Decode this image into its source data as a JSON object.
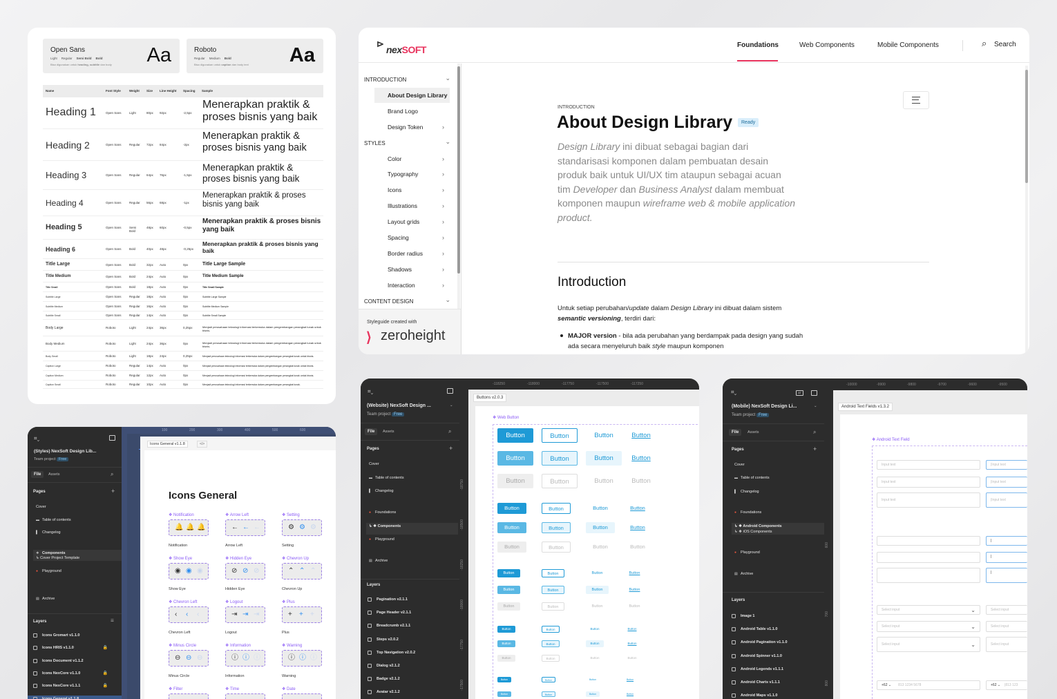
{
  "typography_card": {
    "fonts": [
      {
        "name": "Open Sans",
        "weights": [
          "Light",
          "Regular",
          "Semi Bold",
          "Bold"
        ],
        "desc_pre": "Bisa digunakan untuk ",
        "desc_bold": "heading, subtitle",
        "desc_post": " dan body",
        "sample": "Aa"
      },
      {
        "name": "Roboto",
        "weights": [
          "Regular",
          "Medium",
          "Bold"
        ],
        "desc_pre": "Bisa digunakan untuk ",
        "desc_bold": "caption",
        "desc_post": " dan body text",
        "sample": "Aa"
      }
    ],
    "columns": [
      "Name",
      "Font Style",
      "Weight",
      "Size",
      "Line Height",
      "Spacing",
      "Sample"
    ],
    "rows": [
      {
        "name": "Heading 1",
        "font": "Open Sans",
        "weight": "Light",
        "size": "80px",
        "lh": "92px",
        "sp": "-2,5px",
        "sample": "Menerapkan praktik & proses bisnis yang baik"
      },
      {
        "name": "Heading 2",
        "font": "Open Sans",
        "weight": "Regular",
        "size": "72px",
        "lh": "84px",
        "sp": "-2px",
        "sample": "Menerapkan praktik & proses bisnis yang baik"
      },
      {
        "name": "Heading 3",
        "font": "Open Sans",
        "weight": "Regular",
        "size": "64px",
        "lh": "76px",
        "sp": "-1,5px",
        "sample": "Menerapkan praktik & proses bisnis yang baik"
      },
      {
        "name": "Heading 4",
        "font": "Open Sans",
        "weight": "Regular",
        "size": "56px",
        "lh": "68px",
        "sp": "-1px",
        "sample": "Menerapkan praktik & proses bisnis yang baik"
      },
      {
        "name": "Heading 5",
        "font": "Open Sans",
        "weight": "Semi Bold",
        "size": "48px",
        "lh": "60px",
        "sp": "-0,5px",
        "sample": "Menerapkan praktik & proses bisnis yang baik"
      },
      {
        "name": "Heading 6",
        "font": "Open Sans",
        "weight": "Bold",
        "size": "40px",
        "lh": "48px",
        "sp": "-0,25px",
        "sample": "Menerapkan praktik & proses bisnis yang baik"
      },
      {
        "name": "Title Large",
        "font": "Open Sans",
        "weight": "Bold",
        "size": "32px",
        "lh": "Auto",
        "sp": "0px",
        "sample": "Title Large Sample"
      },
      {
        "name": "Title Medium",
        "font": "Open Sans",
        "weight": "Bold",
        "size": "24px",
        "lh": "Auto",
        "sp": "0px",
        "sample": "Title Medium Sample"
      },
      {
        "name": "Title Small",
        "font": "Open Sans",
        "weight": "Bold",
        "size": "18px",
        "lh": "Auto",
        "sp": "0px",
        "sample": "Title Small Sample"
      },
      {
        "name": "Subtitle Large",
        "font": "Open Sans",
        "weight": "Regular",
        "size": "18px",
        "lh": "Auto",
        "sp": "0px",
        "sample": "Subtitle Large Sample"
      },
      {
        "name": "Subtitle Medium",
        "font": "Open Sans",
        "weight": "Regular",
        "size": "16px",
        "lh": "Auto",
        "sp": "0px",
        "sample": "Subtitle Medium Sample"
      },
      {
        "name": "Subtitle Small",
        "font": "Open Sans",
        "weight": "Regular",
        "size": "14px",
        "lh": "Auto",
        "sp": "0px",
        "sample": "Subtitle Small Sample"
      },
      {
        "name": "Body Large",
        "font": "Roboto",
        "weight": "Light",
        "size": "24px",
        "lh": "36px",
        "sp": "0,25px",
        "sample": "Menjadi perusahaan teknologi informasi terkemuka dalam pengembangan perangkat lunak untuk bisnis."
      },
      {
        "name": "Body Medium",
        "font": "Roboto",
        "weight": "Light",
        "size": "24px",
        "lh": "36px",
        "sp": "0px",
        "sample": "Menjadi perusahaan teknologi informasi terkemuka dalam pengembangan perangkat lunak untuk bisnis."
      },
      {
        "name": "Body Small",
        "font": "Roboto",
        "weight": "Light",
        "size": "18px",
        "lh": "24px",
        "sp": "0,25px",
        "sample": "Menjadi perusahaan teknologi informasi terkemuka dalam pengembangan perangkat lunak untuk bisnis."
      },
      {
        "name": "Caption Large",
        "font": "Roboto",
        "weight": "Regular",
        "size": "14px",
        "lh": "Auto",
        "sp": "0px",
        "sample": "Menjadi perusahaan teknologi informasi terkemuka dalam pengembangan perangkat lunak untuk bisnis."
      },
      {
        "name": "Caption Medium",
        "font": "Roboto",
        "weight": "Regular",
        "size": "12px",
        "lh": "Auto",
        "sp": "0px",
        "sample": "Menjadi perusahaan teknologi informasi terkemuka dalam pengembangan perangkat lunak untuk bisnis."
      },
      {
        "name": "Caption Small",
        "font": "Roboto",
        "weight": "Regular",
        "size": "10px",
        "lh": "Auto",
        "sp": "0px",
        "sample": "Menjadi perusahaan teknologi informasi terkemuka dalam pengembangan perangkat lunak."
      }
    ]
  },
  "docs_site": {
    "logo_pre": "nex",
    "logo_post": "SOFT",
    "nav": [
      "Foundations",
      "Web Components",
      "Mobile Components"
    ],
    "search": "Search",
    "sidebar": [
      {
        "type": "head",
        "label": "INTRODUCTION",
        "chev": "⌄"
      },
      {
        "type": "item",
        "label": "About Design Library",
        "active": true,
        "chev": ""
      },
      {
        "type": "item",
        "label": "Brand Logo",
        "chev": ""
      },
      {
        "type": "item",
        "label": "Design Token",
        "chev": "›"
      },
      {
        "type": "head",
        "label": "STYLES",
        "chev": "⌄"
      },
      {
        "type": "item",
        "label": "Color",
        "chev": "›"
      },
      {
        "type": "item",
        "label": "Typography",
        "chev": "›"
      },
      {
        "type": "item",
        "label": "Icons",
        "chev": "›"
      },
      {
        "type": "item",
        "label": "Illustrations",
        "chev": "›"
      },
      {
        "type": "item",
        "label": "Layout grids",
        "chev": "›"
      },
      {
        "type": "item",
        "label": "Spacing",
        "chev": "›"
      },
      {
        "type": "item",
        "label": "Border radius",
        "chev": "›"
      },
      {
        "type": "item",
        "label": "Shadows",
        "chev": "›"
      },
      {
        "type": "item",
        "label": "Interaction",
        "chev": "›"
      },
      {
        "type": "head",
        "label": "CONTENT DESIGN",
        "chev": "⌄"
      }
    ],
    "styleguide_caption": "Styleguide created with",
    "zeroheight": "zeroheight",
    "eyebrow": "INTRODUCTION",
    "title": "About Design Library",
    "badge": "Ready",
    "lead_parts": [
      {
        "t": "Design Library",
        "i": true
      },
      {
        "t": " ini dibuat sebagai bagian dari standarisasi komponen dalam pembuatan desain produk baik untuk UI/UX tim ataupun sebagai acuan tim ",
        "i": false
      },
      {
        "t": "Developer",
        "i": true
      },
      {
        "t": " dan ",
        "i": false
      },
      {
        "t": "Business Analyst",
        "i": true
      },
      {
        "t": " dalam membuat komponen maupun ",
        "i": false
      },
      {
        "t": "wireframe web & mobile application product.",
        "i": true
      }
    ],
    "section_title": "Introduction",
    "para_parts": [
      {
        "t": "Untuk setiap perubahan/",
        "s": ""
      },
      {
        "t": "update",
        "s": "i"
      },
      {
        "t": " dalam ",
        "s": ""
      },
      {
        "t": "Design Library",
        "s": "i"
      },
      {
        "t": " ini dibuat dalam sistem ",
        "s": ""
      },
      {
        "t": "semantic versioning",
        "s": "bi"
      },
      {
        "t": ", terdiri dari:",
        "s": ""
      }
    ],
    "bullet_parts": [
      {
        "t": "MAJOR version",
        "s": "b"
      },
      {
        "t": " - bila ada perubahan yang berdampak pada design yang sudah ada secara menyeluruh baik ",
        "s": ""
      },
      {
        "t": "style",
        "s": "i"
      },
      {
        "t": " maupun komponen",
        "s": ""
      }
    ],
    "accent": "#e8335d"
  },
  "figma_icons": {
    "project": "(Styles) NexSoft Design Lib...",
    "team": "Team project",
    "plan": "Free",
    "tabs": [
      "File",
      "Assets"
    ],
    "pages_label": "Pages",
    "pages": [
      {
        "label": "Cover",
        "icon": ""
      },
      {
        "label": "Table of contents",
        "icon": "▬"
      },
      {
        "label": "Changelog",
        "icon": "▌"
      },
      {
        "label": "Components",
        "icon": "❖",
        "bold": true
      },
      {
        "label": "↳ Cover Project Template",
        "icon": ""
      },
      {
        "label": "Playground",
        "icon": "●"
      },
      {
        "label": "Archive",
        "icon": "▤"
      }
    ],
    "layers_label": "Layers",
    "layers": [
      "Icons Gromart v1.1.0",
      "Icons HRIS v1.1.0",
      "Icons Document v1.1.2",
      "Icons NexCore v1.1.0",
      "Icons NexCore v1.1.1",
      "Icons General v1.1.8"
    ],
    "ruler": [
      "100",
      "200",
      "300",
      "400",
      "500",
      "600"
    ],
    "frame_tag": "Icons General v1.1.8",
    "heading": "Icons General",
    "icons": [
      {
        "label": "Notification",
        "cap": "Notification",
        "g": [
          "🔔",
          "🔔",
          "🔔"
        ]
      },
      {
        "label": "Arrow Left",
        "cap": "Arrow Left",
        "g": [
          "←",
          "←",
          "←"
        ]
      },
      {
        "label": "Setting",
        "cap": "Setting",
        "g": [
          "⚙",
          "⚙",
          "⚙"
        ]
      },
      {
        "label": "Show Eye",
        "cap": "Show Eye",
        "g": [
          "◉",
          "◉",
          "◉"
        ]
      },
      {
        "label": "Hidden Eye",
        "cap": "Hidden Eye",
        "g": [
          "⊘",
          "⊘",
          "⊘"
        ]
      },
      {
        "label": "Chevron Up",
        "cap": "Chevron Up",
        "g": [
          "⌃",
          "⌃",
          "⌃"
        ]
      },
      {
        "label": "Chevron Left",
        "cap": "Chevron Left",
        "g": [
          "‹",
          "‹",
          "‹"
        ]
      },
      {
        "label": "Logout",
        "cap": "Logout",
        "g": [
          "⇥",
          "⇥",
          "⇥"
        ]
      },
      {
        "label": "Plus",
        "cap": "Plus",
        "g": [
          "+",
          "+",
          "+"
        ]
      },
      {
        "label": "Minus Circle",
        "cap": "Minus Circle",
        "g": [
          "⊖",
          "⊖",
          "⊖"
        ]
      },
      {
        "label": "Information",
        "cap": "Information",
        "g": [
          "ⓘ",
          "ⓘ",
          "ⓘ"
        ]
      },
      {
        "label": "Warning",
        "cap": "Warning",
        "g": [
          "ⓘ",
          "ⓘ",
          "ⓘ"
        ]
      },
      {
        "label": "Filter",
        "cap": "",
        "g": []
      },
      {
        "label": "Time",
        "cap": "",
        "g": []
      },
      {
        "label": "Date",
        "cap": "",
        "g": []
      }
    ]
  },
  "figma_web": {
    "project": "(Website) NexSoft Design ...",
    "team": "Team project",
    "plan": "Free",
    "tabs": [
      "File",
      "Assets"
    ],
    "pages_label": "Pages",
    "pages": [
      {
        "label": "Cover",
        "icon": ""
      },
      {
        "label": "Table of contents",
        "icon": "▬"
      },
      {
        "label": "Changelog",
        "icon": "▌"
      },
      {
        "label": "Foundations",
        "icon": "💧"
      },
      {
        "label": "↳ ❖ Components",
        "icon": "",
        "bold": true
      },
      {
        "label": "Playground",
        "icon": "●"
      },
      {
        "label": "Archive",
        "icon": "▤"
      }
    ],
    "layers_label": "Layers",
    "layers": [
      "Pagination v2.1.1",
      "Page Header v2.1.1",
      "Breadcrumb v2.1.1",
      "Steps v2.0.2",
      "Top Navigation v2.0.2",
      "Dialog v2.1.2",
      "Badge v2.1.2",
      "Avatar v2.1.2"
    ],
    "ruler": [
      "-118250",
      "-118000",
      "-117750",
      "-117500",
      "-117250"
    ],
    "vruler": [
      "-18750",
      "-18500",
      "-18250",
      "-18000",
      "-17750",
      "-17500"
    ],
    "frame_tag": "Buttons v2.0.3",
    "comp_label": "Web Button",
    "btn": "Button"
  },
  "figma_mobile": {
    "project": "(Mobile) NexSoft Design Li...",
    "team": "Team project",
    "plan": "Free",
    "tabs": [
      "File",
      "Assets"
    ],
    "pages_label": "Pages",
    "pages": [
      {
        "label": "Cover",
        "icon": ""
      },
      {
        "label": "Table of contents",
        "icon": "▬"
      },
      {
        "label": "Changelog",
        "icon": "▌"
      },
      {
        "label": "Foundations",
        "icon": "💧"
      },
      {
        "label": "↳ ❖ Android Components",
        "icon": "",
        "bold": true
      },
      {
        "label": "↳ ❖ iOS Components",
        "icon": ""
      },
      {
        "label": "Playground",
        "icon": "●"
      },
      {
        "label": "Archive",
        "icon": "▤"
      }
    ],
    "layers_label": "Layers",
    "layers": [
      "Image 1",
      "Android Table v1.1.0",
      "Android Pagination v1.1.0",
      "Android Spinner v1.1.0",
      "Android Legends v1.1.1",
      "Android Charts v1.1.1",
      "Android Maps  v1.1.0"
    ],
    "ruler": [
      "-10000",
      "-9900",
      "-9800",
      "-9700",
      "-9600",
      "-9500"
    ],
    "vruler": [
      "600",
      "700",
      "800"
    ],
    "frame_tag": "Android Text Fields v1.3.2",
    "comp_label": "Android Text Field",
    "input": "Input text",
    "select": "Select input",
    "phone_code": "+62",
    "phone_ph": "813 1234 5678",
    "phone_ph2": "813 123"
  }
}
